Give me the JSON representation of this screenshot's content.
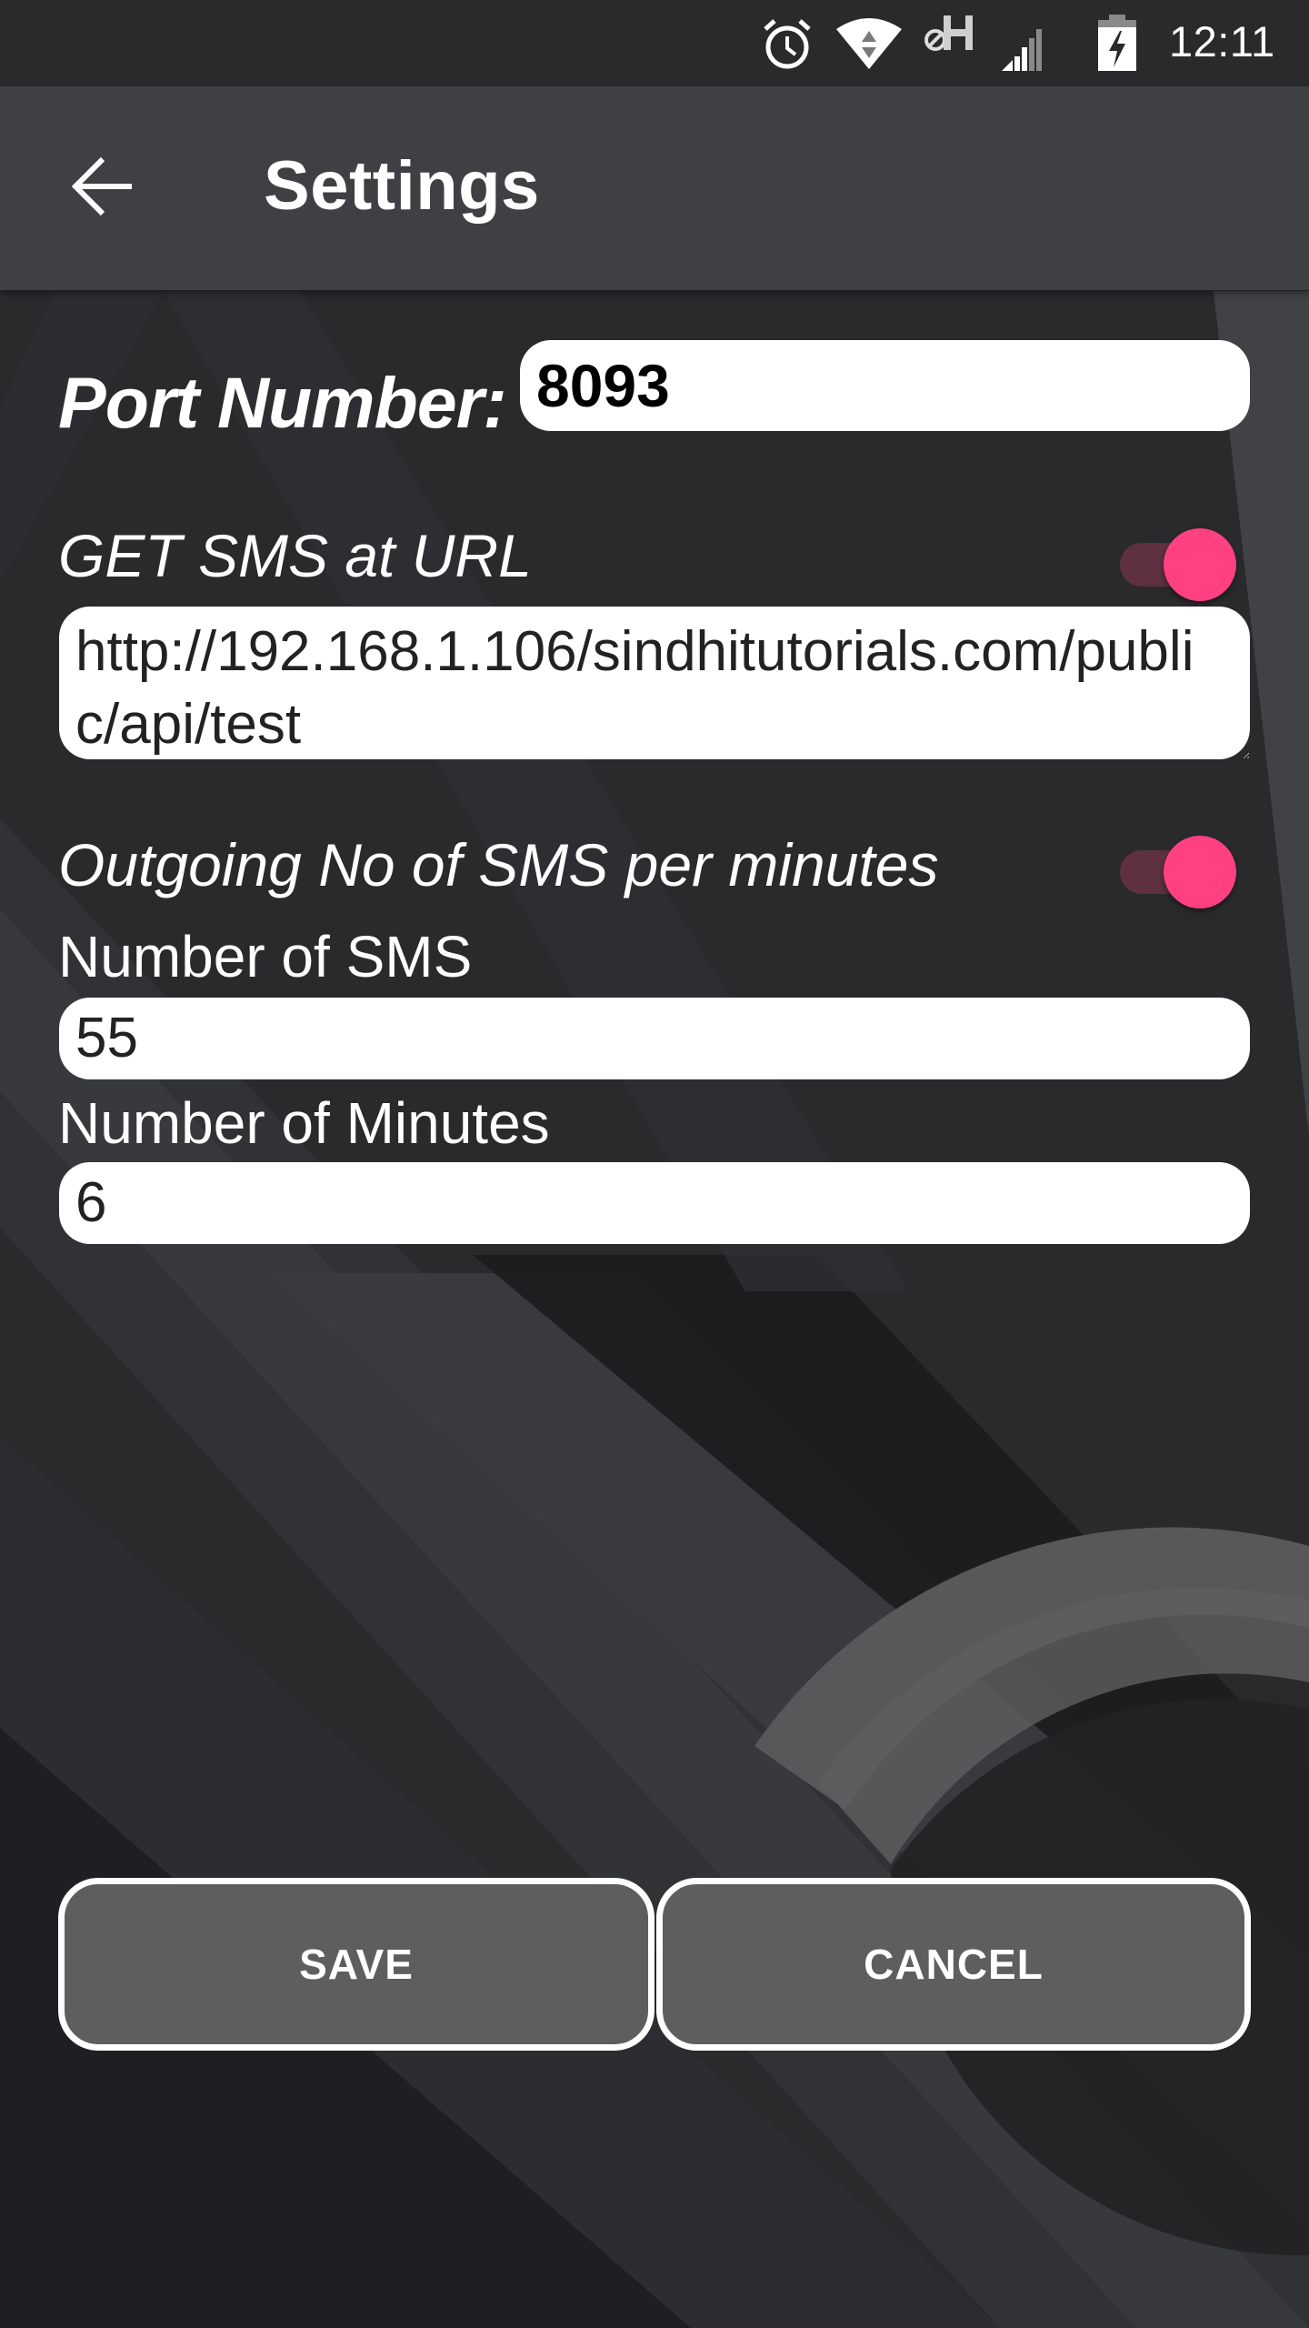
{
  "status_bar": {
    "time": "12:11",
    "icons": [
      "alarm-icon",
      "wifi-icon",
      "data-h-icon",
      "signal-icon",
      "battery-charging-icon"
    ]
  },
  "toolbar": {
    "back_icon": "arrow-left-icon",
    "title": "Settings"
  },
  "port": {
    "label": "Port Number:",
    "value": "8093"
  },
  "get_sms": {
    "label": "GET SMS at URL",
    "toggle_on": true,
    "url_value": "http://192.168.1.106/sindhitutorials.com/public/api/test"
  },
  "outgoing": {
    "label": "Outgoing No of SMS per minutes",
    "toggle_on": true,
    "sms_count_label": "Number of SMS",
    "sms_count_value": "55",
    "minutes_label": "Number of Minutes",
    "minutes_value": "6"
  },
  "actions": {
    "save_label": "SAVE",
    "cancel_label": "CANCEL"
  },
  "colors": {
    "accent": "#FF4081",
    "toggle_track": "#5E3042",
    "toolbar": "#3F4044",
    "status_bar": "#2A2A2C",
    "button_fill": "#5E5E60"
  }
}
